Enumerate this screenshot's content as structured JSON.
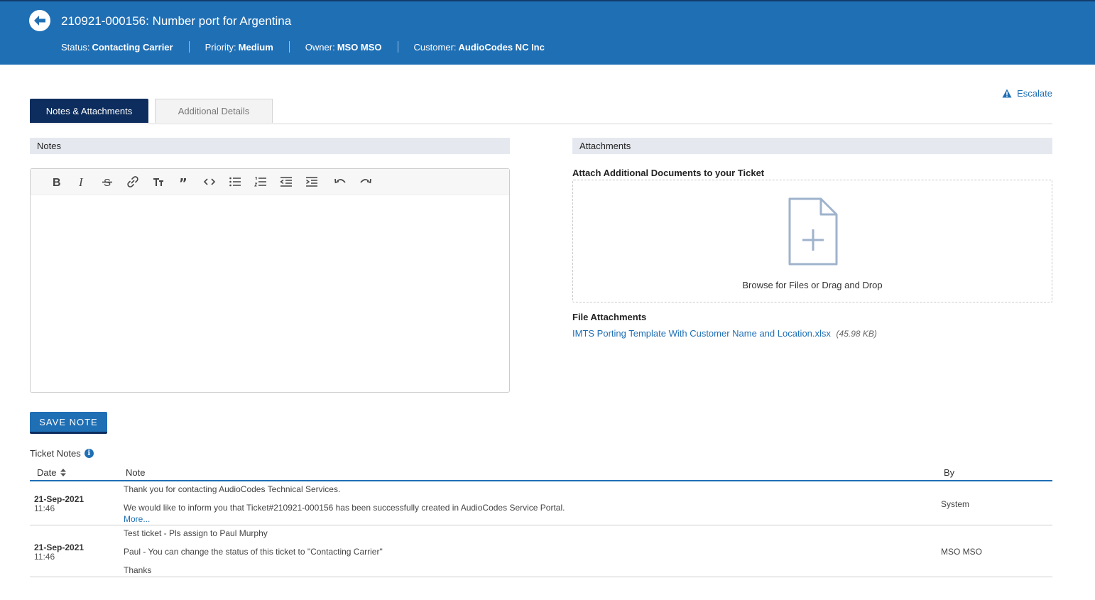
{
  "header": {
    "title": "210921-000156: Number port for Argentina",
    "status_label": "Status:",
    "status_value": "Contacting Carrier",
    "priority_label": "Priority:",
    "priority_value": "Medium",
    "owner_label": "Owner:",
    "owner_value": "MSO MSO",
    "customer_label": "Customer:",
    "customer_value": "AudioCodes NC Inc",
    "back_icon": "arrow-left-circle-icon"
  },
  "escalate": {
    "label": "Escalate",
    "icon": "warning-triangle-icon"
  },
  "tabs": [
    {
      "label": "Notes & Attachments",
      "active": true
    },
    {
      "label": "Additional Details",
      "active": false
    }
  ],
  "notes_section": {
    "heading": "Notes",
    "toolbar": [
      "bold-icon",
      "italic-icon",
      "strikethrough-icon",
      "link-icon",
      "text-size-icon",
      "blockquote-icon",
      "code-icon",
      "bulleted-list-icon",
      "numbered-list-icon",
      "outdent-icon",
      "indent-icon",
      "undo-icon",
      "redo-icon"
    ],
    "save_label": "SAVE NOTE"
  },
  "attachments_section": {
    "heading": "Attachments",
    "attach_title": "Attach Additional Documents to your Ticket",
    "drop_text": "Browse for Files or Drag and Drop",
    "files_title": "File Attachments",
    "files": [
      {
        "name": "IMTS Porting Template With Customer Name and Location.xlsx",
        "size": "(45.98 KB)"
      }
    ]
  },
  "ticket_notes": {
    "title": "Ticket Notes",
    "columns": {
      "date": "Date",
      "note": "Note",
      "by": "By"
    },
    "rows": [
      {
        "date": "21-Sep-2021",
        "time": "11:46",
        "lines": [
          "Thank you for contacting AudioCodes Technical Services.",
          "We would like to inform you that Ticket#210921-000156 has been successfully created in AudioCodes Service Portal."
        ],
        "more": "More...",
        "by": "System"
      },
      {
        "date": "21-Sep-2021",
        "time": "11:46",
        "lines": [
          "Test ticket - Pls assign to Paul Murphy",
          "Paul - You can change the status of this ticket to \"Contacting Carrier\"",
          "Thanks"
        ],
        "by": "MSO MSO"
      }
    ]
  },
  "colors": {
    "header_bg": "#1f6fb5",
    "active_tab_bg": "#0d2d5e",
    "link": "#1f6fb5",
    "section_head_bg": "#e5e9ef"
  }
}
